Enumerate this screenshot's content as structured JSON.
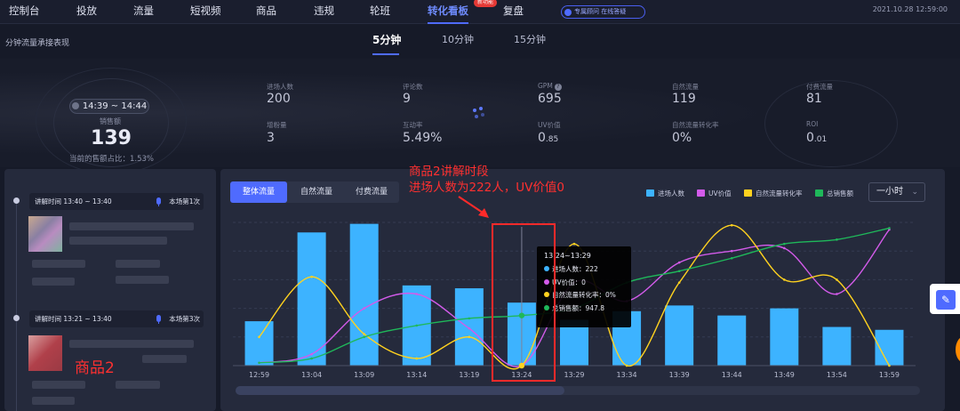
{
  "nav": {
    "items": [
      {
        "label": "控制台",
        "active": false
      },
      {
        "label": "投放",
        "active": false
      },
      {
        "label": "流量",
        "active": false
      },
      {
        "label": "短视频",
        "active": false
      },
      {
        "label": "商品",
        "active": false
      },
      {
        "label": "违规",
        "active": false
      },
      {
        "label": "轮班",
        "active": false
      },
      {
        "label": "转化看板",
        "active": true
      },
      {
        "label": "复盘",
        "active": false
      }
    ],
    "badge": "新功能",
    "consult": "专属顾问 在线答疑",
    "timestamp": "2021.10.28 12:59:00"
  },
  "header": {
    "section_title": "分钟流量承接表现",
    "tabs": [
      "5分钟",
      "10分钟",
      "15分钟"
    ],
    "active_tab": 0
  },
  "overview": {
    "time_range": "14:39 ~ 14:44",
    "sales_label": "销售额",
    "sales_value": "139",
    "sales_sub": "当前的售额占比：1.53%",
    "metrics": [
      {
        "label": "进场人数",
        "value": "200"
      },
      {
        "label": "评论数",
        "value": "9"
      },
      {
        "label": "GPM",
        "value": "695",
        "help": true
      },
      {
        "label": "自然流量",
        "value": "119"
      },
      {
        "label": "付费流量",
        "value": "81"
      },
      {
        "label": "增粉量",
        "value": "3"
      },
      {
        "label": "互动率",
        "value": "5.49%"
      },
      {
        "label": "UV价值",
        "value_main": "0",
        "value_small": ".85"
      },
      {
        "label": "自然流量转化率",
        "value": "0%"
      },
      {
        "label": "ROI",
        "value_main": "0",
        "value_small": ".01"
      }
    ]
  },
  "segments": [
    {
      "label": "讲解时间 13:40 ~ 13:40",
      "order": "本场第1次"
    },
    {
      "label": "讲解时间 13:21 ~ 13:40",
      "order": "本场第3次"
    }
  ],
  "product_annotation": "商品2",
  "flow_tabs": [
    "整体流量",
    "自然流量",
    "付费流量"
  ],
  "active_flow_tab": 0,
  "legend": [
    {
      "name": "进场人数",
      "color": "#3db3ff"
    },
    {
      "name": "UV价值",
      "color": "#d35bea"
    },
    {
      "name": "自然流量转化率",
      "color": "#ffd21f"
    },
    {
      "name": "总销售额",
      "color": "#1fb85a"
    }
  ],
  "range_select": "一小时",
  "annotation": {
    "line1": "商品2讲解时段",
    "line2": "进场人数为222人，UV价值0"
  },
  "tooltip": {
    "title": "13:24~13:29",
    "rows": [
      {
        "label": "进场人数：222",
        "color": "#3db3ff"
      },
      {
        "label": "UV价值：0",
        "color": "#d35bea"
      },
      {
        "label": "自然流量转化率：0%",
        "color": "#ffd21f"
      },
      {
        "label": "总销售额：947.8",
        "color": "#1fb85a"
      }
    ]
  },
  "chart_data": {
    "type": "bar",
    "categories": [
      "12:59",
      "13:04",
      "13:09",
      "13:14",
      "13:19",
      "13:24",
      "13:29",
      "13:34",
      "13:39",
      "13:44",
      "13:49",
      "13:54",
      "13:59"
    ],
    "ylim": [
      0,
      1
    ],
    "grid": true,
    "legend": "top-right",
    "series": [
      {
        "name": "进场人数",
        "type": "bar",
        "color": "#3db3ff",
        "values": [
          0.31,
          0.93,
          0.99,
          0.56,
          0.54,
          0.44,
          0.32,
          0.38,
          0.42,
          0.35,
          0.4,
          0.27,
          0.25
        ]
      },
      {
        "name": "UV价值",
        "type": "line",
        "color": "#d35bea",
        "values": [
          0.02,
          0.08,
          0.4,
          0.5,
          0.26,
          0.0,
          0.58,
          0.45,
          0.72,
          0.8,
          0.82,
          0.5,
          0.95
        ]
      },
      {
        "name": "自然流量转化率",
        "type": "line",
        "color": "#ffd21f",
        "values": [
          0.2,
          0.62,
          0.22,
          0.05,
          0.2,
          0.0,
          0.85,
          0.0,
          0.58,
          0.98,
          0.6,
          0.6,
          0.0
        ]
      },
      {
        "name": "总销售额",
        "type": "line",
        "color": "#1fb85a",
        "values": [
          0.02,
          0.05,
          0.2,
          0.28,
          0.33,
          0.35,
          0.4,
          0.58,
          0.66,
          0.75,
          0.85,
          0.88,
          0.96
        ]
      }
    ]
  }
}
